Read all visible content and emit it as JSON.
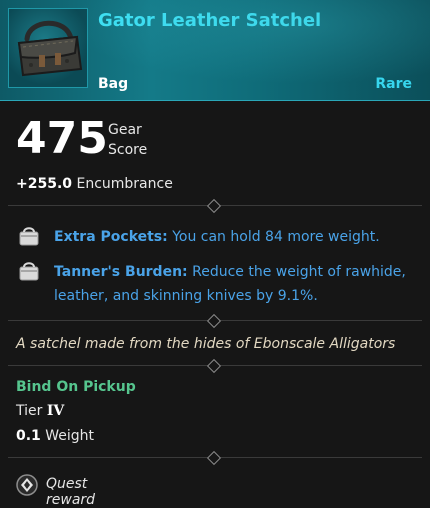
{
  "item": {
    "name": "Gator Leather Satchel",
    "type": "Bag",
    "rarity": "Rare"
  },
  "stats": {
    "gear_score_value": "475",
    "gear_score_label_line1": "Gear",
    "gear_score_label_line2": "Score",
    "encumbrance_value": "+255.0",
    "encumbrance_label": "Encumbrance"
  },
  "perks": [
    {
      "name": "Extra Pockets:",
      "description": "You can hold 84 more weight."
    },
    {
      "name": "Tanner's Burden:",
      "description": "Reduce the weight of rawhide, leather, and skinning knives by 9.1%."
    }
  ],
  "flavor_text": "A satchel made from the hides of Ebonscale Alligators",
  "binding": "Bind On Pickup",
  "tier": {
    "label": "Tier",
    "value": "IV"
  },
  "weight": {
    "value": "0.1",
    "label": "Weight"
  },
  "source": {
    "label": "Quest reward"
  },
  "colors": {
    "rarity_accent": "#37d6ee",
    "perk_text": "#4aa3e8",
    "bind_text": "#56c58e",
    "flavor_text": "#e2d8c2"
  },
  "icons": {
    "item": "leather-satchel-icon",
    "perk": "bag-perk-icon",
    "source": "quest-reward-diamond-icon"
  }
}
